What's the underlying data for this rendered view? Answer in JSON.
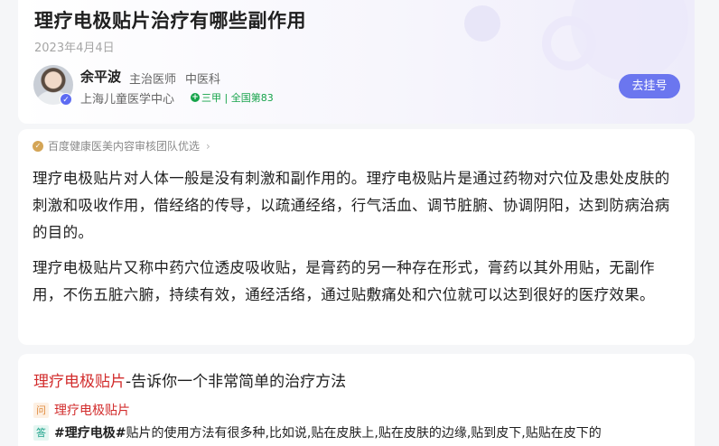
{
  "header": {
    "title": "理疗电极贴片治疗有哪些副作用",
    "date": "2023年4月4日"
  },
  "doctor": {
    "name": "余平波",
    "title": "主治医师",
    "department": "中医科",
    "hospital": "上海儿童医学中心",
    "hospital_badge": "三甲 | 全国第83",
    "register_button": "去挂号"
  },
  "content": {
    "source_label": "百度健康医美内容审核团队优选",
    "paragraphs": [
      "理疗电极贴片对人体一般是没有刺激和副作用的。理疗电极贴片是通过药物对穴位及患处皮肤的刺激和吸收作用，借经络的传导，以疏通经络，行气活血、调节脏腑、协调阴阳，达到防病治病的目的。",
      "理疗电极贴片又称中药穴位透皮吸收贴，是膏药的另一种存在形式，膏药以其外用贴，无副作用，不伤五脏六腑，持续有效，通经活络，通过贴敷痛处和穴位就可以达到很好的医疗效果。"
    ]
  },
  "related": {
    "title_highlight": "理疗电极贴片",
    "title_rest": "-告诉你一个非常简单的治疗方法",
    "q_tag": "问",
    "question": "理疗电极贴片",
    "a_tag": "答",
    "answer_bold": "#理疗电极#",
    "answer_rest": "贴片的使用方法有很多种,比如说,贴在皮肤上,贴在皮肤的边缘,贴到皮下,贴贴在皮下的"
  },
  "icons": {
    "verified": "verified-check-icon",
    "hospital_plus": "plus-circle-icon",
    "source_medal": "medal-icon",
    "chevron": "chevron-right-icon"
  },
  "colors": {
    "accent": "#6b76ef",
    "highlight_red": "#d22c2c",
    "badge_green": "#16a34a"
  }
}
